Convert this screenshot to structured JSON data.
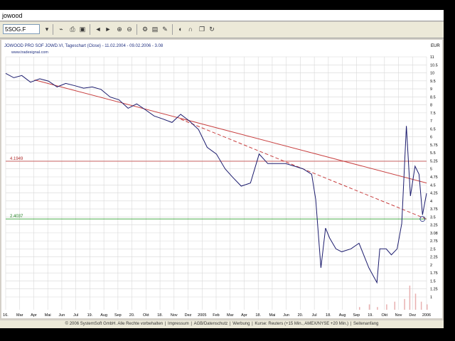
{
  "window": {
    "title": "jowood"
  },
  "toolbar": {
    "symbol_value": "5SOG.F",
    "icons": [
      "chart-type-icon",
      "print-icon",
      "save-icon",
      "prev-icon",
      "next-icon",
      "zoom-in-icon",
      "zoom-out-icon",
      "settings-icon",
      "indicator-icon",
      "draw-icon",
      "color-icon",
      "magnet-icon",
      "copy-icon",
      "refresh-icon"
    ]
  },
  "chart": {
    "header": "JOWOOD PRO SOF JOWD.VI, Tageschart (Close) - 11.02.2004 - 09.02.2006 - 3.08",
    "source": "www.tradesignal.com",
    "currency": "EUR",
    "level_high": "4.1949",
    "level_low": "2.4037",
    "x_labels": [
      "16.",
      "Mar",
      "Apr",
      "Mai",
      "Jun",
      "Jul",
      "19.",
      "Aug",
      "Sep",
      "20.",
      "Okt",
      "18.",
      "Nov",
      "Dez",
      "2005",
      "Feb",
      "Mar",
      "Apr",
      "18.",
      "Mai",
      "Jun",
      "20.",
      "Jul",
      "18.",
      "Aug",
      "Sep",
      "19.",
      "Okt",
      "Nov",
      "Dez",
      "2006"
    ],
    "y_labels": [
      "11",
      "10.5",
      "10",
      "9.5",
      "9",
      "8.5",
      "8",
      "7.5",
      "7",
      "6.5",
      "6",
      "5.75",
      "5.5",
      "5.25",
      "5",
      "4.75",
      "4.5",
      "4.25",
      "4",
      "3.75",
      "3.5",
      "3.25",
      "3.08",
      "2.75",
      "2.5",
      "2.25",
      "2",
      "1.75",
      "1.5",
      "1.25",
      "1"
    ]
  },
  "colors": {
    "price_line": "#1c1c6e",
    "trendline": "#c84040",
    "support_line": "#30a030",
    "grid": "#d8d8d8"
  },
  "chart_data": {
    "type": "line",
    "title": "JOWOOD PRO SOF JOWD.VI, Tageschart (Close) - 11.02.2004 - 09.02.2006 - 3.08",
    "ylabel": "EUR",
    "y_scale": "log",
    "ylim": [
      1,
      11.5
    ],
    "series": [
      {
        "name": "Close",
        "x": [
          "2004-02-11",
          "2004-02-25",
          "2004-03-10",
          "2004-03-25",
          "2004-04-10",
          "2004-04-25",
          "2004-05-10",
          "2004-05-25",
          "2004-06-10",
          "2004-06-25",
          "2004-07-10",
          "2004-07-25",
          "2004-08-10",
          "2004-08-25",
          "2004-09-10",
          "2004-09-25",
          "2004-10-10",
          "2004-10-25",
          "2004-11-10",
          "2004-11-25",
          "2004-12-10",
          "2004-12-25",
          "2005-01-10",
          "2005-01-25",
          "2005-02-10",
          "2005-02-25",
          "2005-03-10",
          "2005-03-25",
          "2005-04-10",
          "2005-04-25",
          "2005-05-10",
          "2005-05-25",
          "2005-06-10",
          "2005-06-25",
          "2005-07-10",
          "2005-07-25",
          "2005-08-01",
          "2005-08-10",
          "2005-08-18",
          "2005-08-25",
          "2005-09-05",
          "2005-09-15",
          "2005-10-01",
          "2005-10-15",
          "2005-11-01",
          "2005-11-15",
          "2005-11-20",
          "2005-12-01",
          "2005-12-10",
          "2005-12-20",
          "2005-12-28",
          "2006-01-05",
          "2006-01-12",
          "2006-01-20",
          "2006-01-27",
          "2006-02-02",
          "2006-02-09"
        ],
        "y": [
          9.8,
          9.4,
          9.6,
          9.0,
          9.3,
          9.1,
          8.6,
          8.9,
          8.7,
          8.5,
          8.6,
          8.4,
          7.8,
          7.6,
          7.0,
          7.3,
          6.9,
          6.5,
          6.3,
          6.1,
          6.6,
          6.2,
          5.7,
          4.8,
          4.5,
          3.9,
          3.6,
          3.3,
          3.4,
          4.5,
          4.1,
          4.1,
          4.1,
          4.0,
          3.9,
          3.7,
          2.9,
          1.5,
          2.2,
          2.0,
          1.8,
          1.75,
          1.8,
          1.9,
          1.5,
          1.3,
          1.8,
          1.8,
          1.7,
          1.8,
          2.3,
          5.9,
          3.0,
          4.0,
          3.7,
          2.5,
          3.08
        ]
      },
      {
        "name": "Volume",
        "x": [
          "2005-10-15",
          "2005-11-01",
          "2005-11-15",
          "2005-12-01",
          "2005-12-15",
          "2006-01-01",
          "2006-01-10",
          "2006-01-20",
          "2006-01-30",
          "2006-02-09"
        ],
        "y": [
          1,
          2,
          1,
          2,
          3,
          4,
          9,
          6,
          3,
          2
        ]
      }
    ],
    "annotations": [
      {
        "type": "horizontal_line",
        "value": 4.1949,
        "label": "4.1949"
      },
      {
        "type": "horizontal_line",
        "value": 2.4037,
        "label": "2.4037"
      },
      {
        "type": "trendline",
        "from": [
          "2004-04-01",
          9.2
        ],
        "to": [
          "2006-02-09",
          3.4
        ]
      },
      {
        "type": "trendline_dashed",
        "from": [
          "2004-12-10",
          6.3
        ],
        "to": [
          "2006-02-09",
          2.4
        ]
      }
    ],
    "grid": true,
    "legend": "none"
  },
  "footer": {
    "copyright": "© 2006 SystemSoft GmbH. Alle Rechte vorbehalten",
    "links": [
      "Impressum",
      "AGB/Datenschutz",
      "Werbung",
      "Kurse: Reuters (+15 Min., AMEX/NYSE +20 Min.)",
      "Seitenanfang"
    ]
  }
}
